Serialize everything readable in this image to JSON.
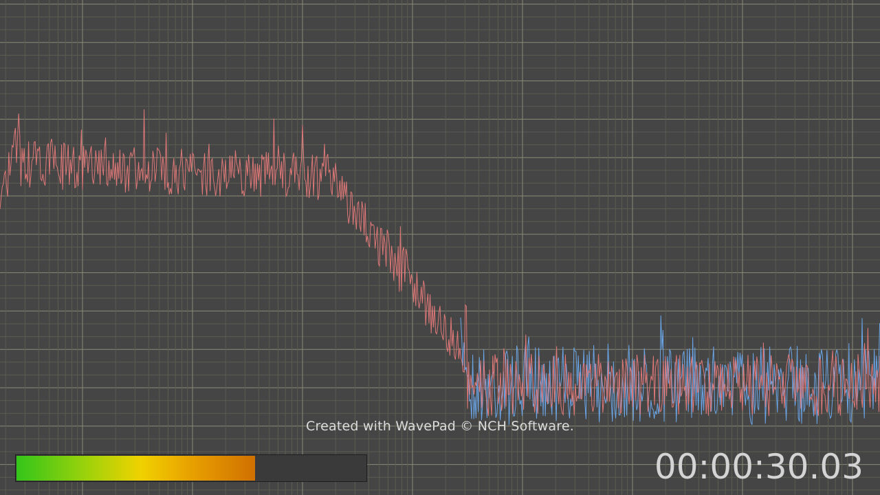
{
  "watermark": {
    "text": "Created with WavePad © NCH Software."
  },
  "level_meter": {
    "level_fraction": 0.68,
    "gradient_colors": [
      "#33c51a",
      "#f0d200",
      "#d07000"
    ]
  },
  "time_display": {
    "value": "00:00:30.03"
  },
  "colors": {
    "background": "#454545",
    "grid_minor": "#5c5c52",
    "grid_major": "#8a8a78",
    "channel_left": "#e07878",
    "channel_right": "#6aa6e8"
  }
}
